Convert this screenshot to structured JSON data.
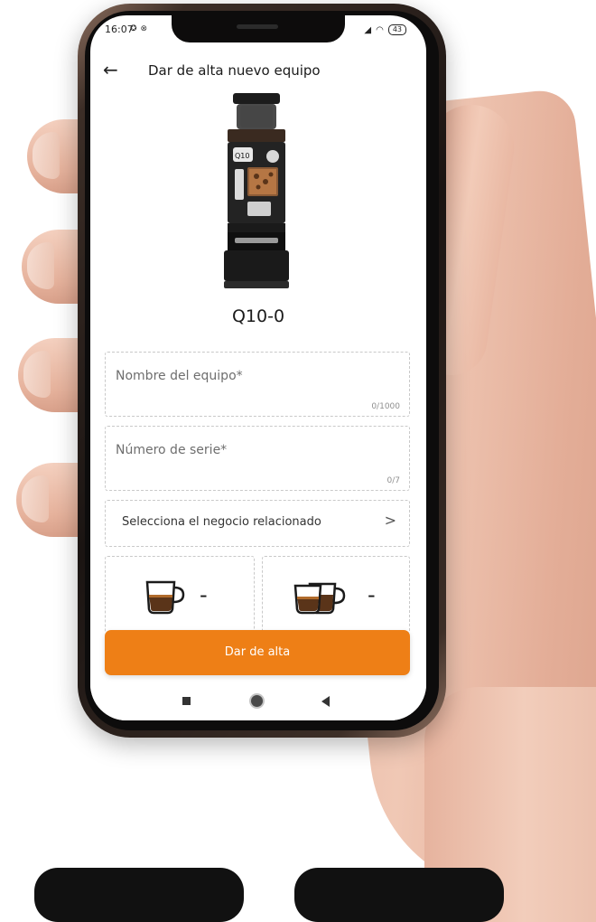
{
  "status_bar": {
    "time": "16:07",
    "notification_icons": [
      "check-circle-icon",
      "sync-icon"
    ],
    "battery": "43"
  },
  "appbar": {
    "back_label": "←",
    "title": "Dar de alta nuevo equipo"
  },
  "product": {
    "model": "Q10-0"
  },
  "form": {
    "name_placeholder": "Nombre del equipo*",
    "name_counter": "0/1000",
    "serial_placeholder": "Número de serie*",
    "serial_counter": "0/7",
    "business_select_label": "Selecciona el negocio relacionado",
    "business_chevron": ">"
  },
  "cups": {
    "single_value": "-",
    "double_value": "-"
  },
  "actions": {
    "submit_label": "Dar de alta"
  },
  "colors": {
    "accent": "#ee7f16",
    "coffee": "#5a3419"
  }
}
